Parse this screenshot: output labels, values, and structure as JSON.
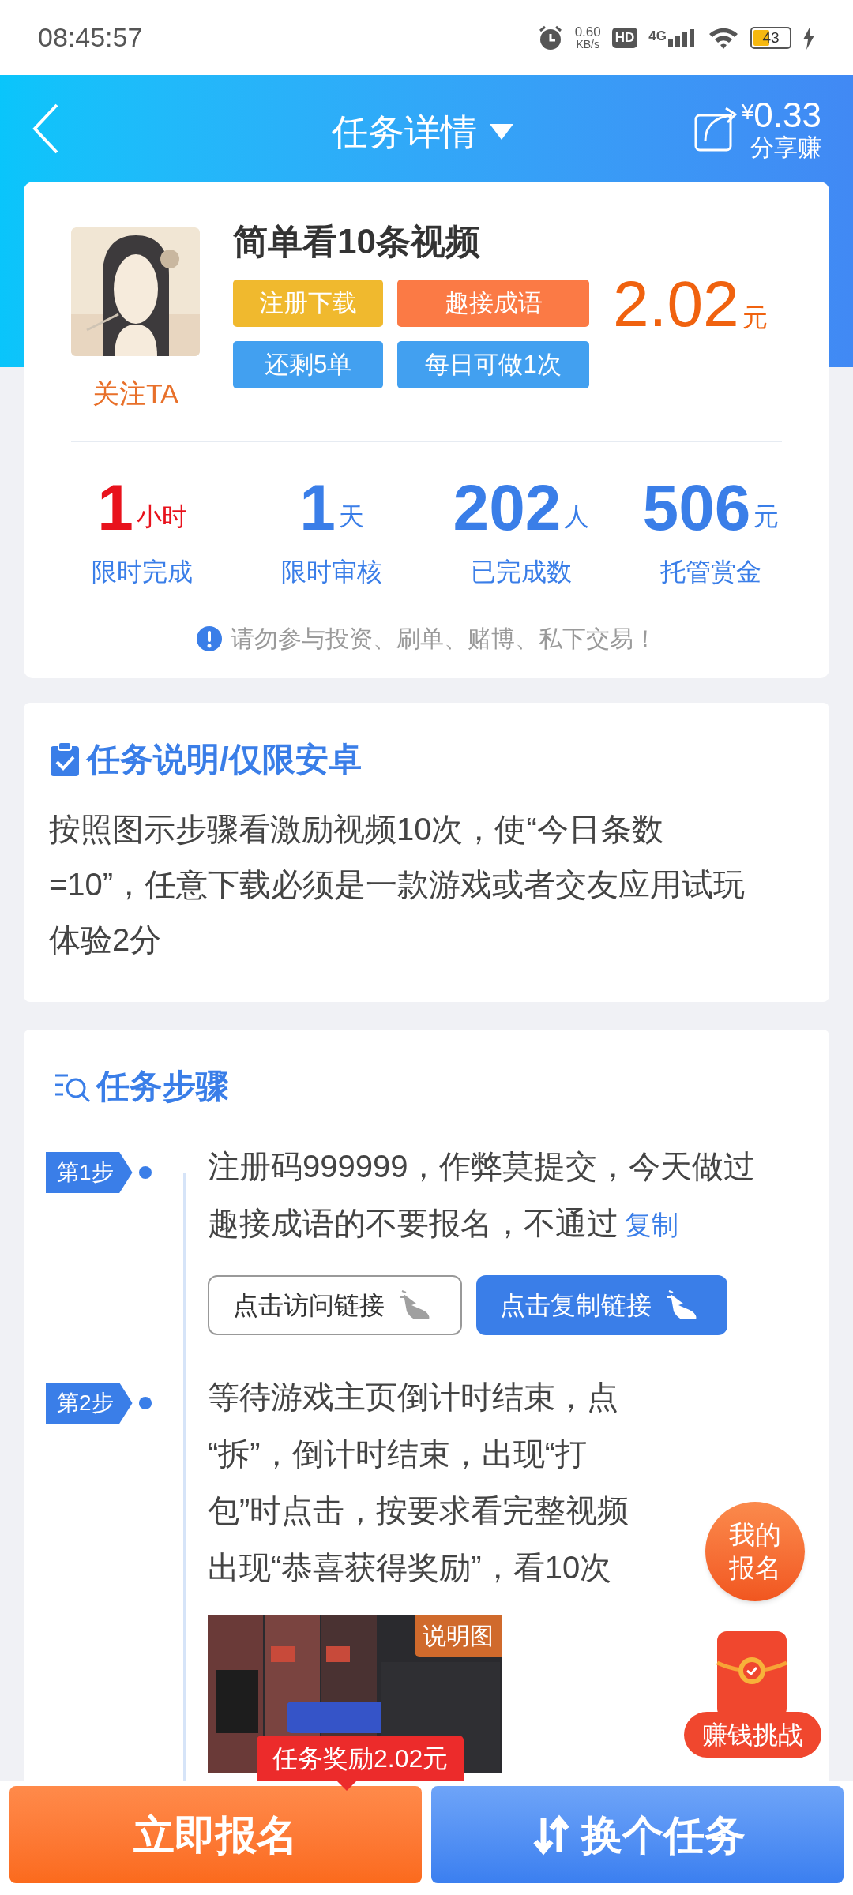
{
  "status_bar": {
    "time": "08:45:57",
    "net_speed": "0.60",
    "net_unit": "KB/s",
    "hd": "HD",
    "network": "4G",
    "battery": "43"
  },
  "header": {
    "title": "任务详情",
    "share_currency": "¥",
    "share_amount": "0.33",
    "share_label": "分享赚"
  },
  "task": {
    "follow": "关注TA",
    "title": "简单看10条视频",
    "price": "2.02",
    "price_unit": "元",
    "tags": [
      {
        "label": "注册下载",
        "color": "#f0b92e"
      },
      {
        "label": "趣接成语",
        "color": "#fb7a45"
      },
      {
        "label": "还剩5单",
        "color": "#42a0f0"
      },
      {
        "label": "每日可做1次",
        "color": "#42a0f0"
      }
    ],
    "stats": [
      {
        "value": "1",
        "unit": "小时",
        "label": "限时完成",
        "color": "#e8121c"
      },
      {
        "value": "1",
        "unit": "天",
        "label": "限时审核",
        "color": "#3a7ee8"
      },
      {
        "value": "202",
        "unit": "人",
        "label": "已完成数",
        "color": "#3a7ee8"
      },
      {
        "value": "506",
        "unit": "元",
        "label": "托管赏金",
        "color": "#3a7ee8"
      }
    ],
    "warning": "请勿参与投资、刷单、赌博、私下交易！"
  },
  "description": {
    "title": "任务说明/仅限安卓",
    "text": "按照图示步骤看激励视频10次，使“今日条数=10”，任意下载必须是一款游戏或者交友应用试玩体验2分"
  },
  "steps": {
    "title": "任务步骤",
    "items": [
      {
        "badge": "第1步",
        "text": "注册码999999，作弊莫提交，今天做过趣接成语的不要报名，不通过",
        "link": "复制",
        "buttons": [
          {
            "label": "点击访问链接",
            "kind": "outline"
          },
          {
            "label": "点击复制链接",
            "kind": "primary"
          }
        ]
      },
      {
        "badge": "第2步",
        "lines": [
          "等待游戏主页倒计时结束，点",
          "“拆”，倒计时结束，出现“打",
          "包”时点击，按要求看完整视频",
          "出现“恭喜获得奖励”，看10次"
        ],
        "image": {
          "kind": "picture",
          "caption": "说明图"
        }
      }
    ]
  },
  "floating": {
    "my_signup": "我的报名",
    "challenge": "赚钱挑战"
  },
  "reward_tip": "任务奖励2.02元",
  "actions": [
    {
      "label": "立即报名",
      "kind": "primary"
    },
    {
      "label": "换个任务",
      "kind": "secondary"
    }
  ]
}
